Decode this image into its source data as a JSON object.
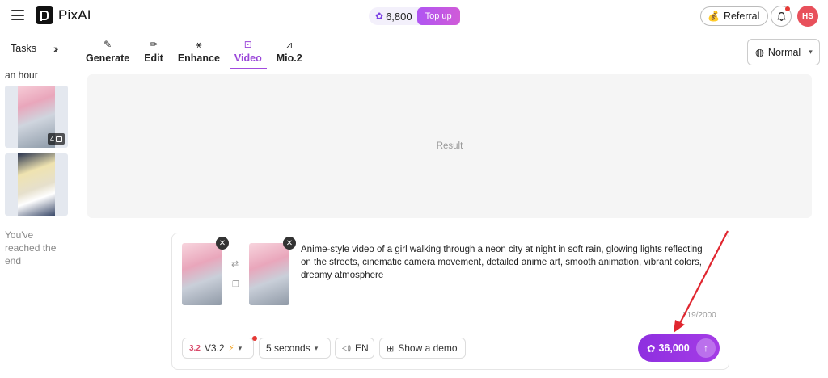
{
  "app": {
    "name": "PixAI"
  },
  "header": {
    "credits": "6,800",
    "topup_label": "Top up",
    "referral_label": "Referral",
    "avatar_initials": "HS"
  },
  "sidebar": {
    "tasks_label": "Tasks",
    "time_group": "an hour",
    "thumb_badge_count": "4",
    "end_text": "You've reached the end"
  },
  "tabs": [
    {
      "label": "Generate",
      "icon": "brush-icon"
    },
    {
      "label": "Edit",
      "icon": "pencil-icon"
    },
    {
      "label": "Enhance",
      "icon": "sparkle-icon"
    },
    {
      "label": "Video",
      "icon": "video-icon",
      "active": true
    },
    {
      "label": "Mio.2",
      "icon": "mio-icon"
    }
  ],
  "mode": {
    "label": "Normal"
  },
  "result": {
    "placeholder": "Result"
  },
  "prompt": {
    "text": "Anime-style video of a girl walking through a neon city at night in soft rain, glowing lights reflecting on the streets, cinematic camera movement, detailed anime art, smooth animation, vibrant colors, dreamy atmosphere",
    "char_count": "219/2000"
  },
  "controls": {
    "model_logo": "3.2",
    "model_label": "V3.2",
    "duration_label": "5 seconds",
    "language_label": "EN",
    "demo_label": "Show a demo",
    "generate_cost": "36,000"
  },
  "colors": {
    "accent": "#9a46d9",
    "generate_button": "#8e2fe0",
    "annotation_arrow": "#e0262f"
  }
}
